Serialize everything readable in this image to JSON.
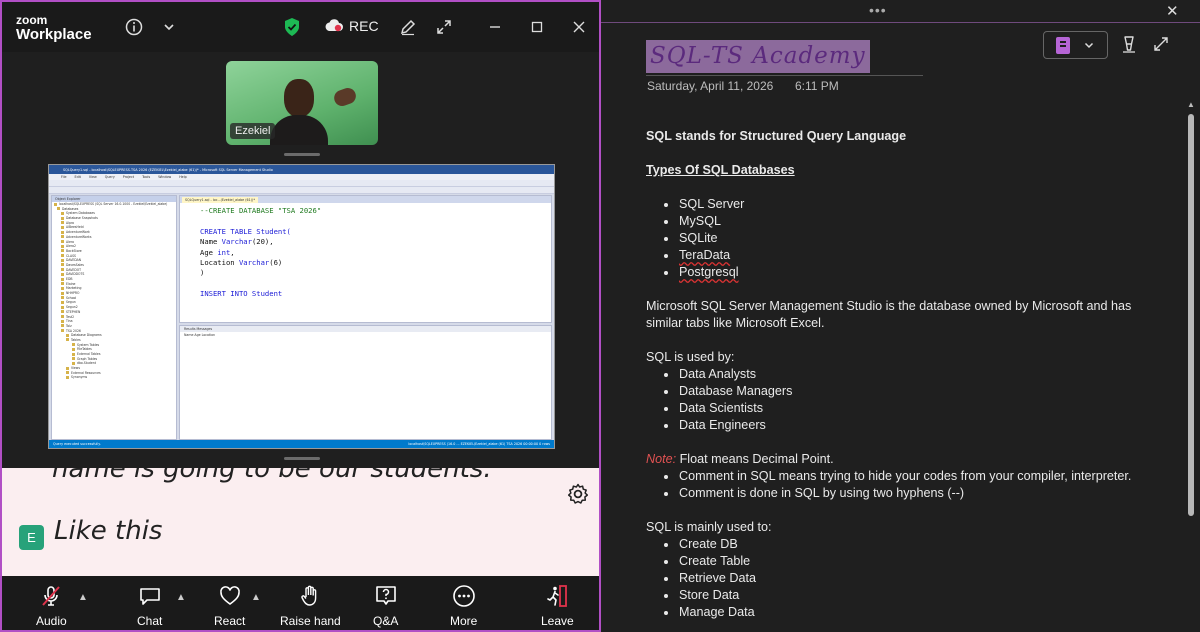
{
  "zoom": {
    "logo_line1": "zoom",
    "logo_line2": "Workplace",
    "rec_label": "REC",
    "participant_name": "Ezekiel",
    "shared_screen": {
      "window_title": "SQLQuery1.sql - localhost\\SQLEXPRESS.TSA 2026 (EZEKIEL\\Ezekiel_alabe (61))* - Microsoft SQL Server Management Studio",
      "menu": [
        "File",
        "Edit",
        "View",
        "Query",
        "Project",
        "Tools",
        "Window",
        "Help"
      ],
      "explorer_header": "Object Explorer",
      "tree": [
        "localhost\\SQLEXPRESS (SQL Server 16.0.1000 - Ezekiel\\Ezekiel_alabe)",
        "Databases",
        "System Databases",
        "Database Snapshots",
        "Alpro",
        "AlBeesHeld",
        "AdventureWork",
        "AdventureWorks",
        "Alero",
        "Alero2",
        "BackStore",
        "CLASS",
        "DAVEDAN",
        "DavesSales",
        "DAVEDOT",
        "DAVIDDOTS",
        "EDB",
        "Elaine",
        "Marketing",
        "NHHPRO",
        "School",
        "Segun",
        "Segun2",
        "STEPHEN",
        "Test2",
        "Tina",
        "Tolz",
        "TSA 2026",
        "Database Diagrams",
        "Tables",
        "System Tables",
        "FileTables",
        "External Tables",
        "Graph Tables",
        "dbo.Student",
        "Views",
        "External Resources",
        "Synonyms"
      ],
      "tab_label": "SQLQuery1.sql - loc...(Ezekiel_alabe (61))*",
      "code_lines": [
        {
          "text": "--CREATE DATABASE \"TSA 2026\"",
          "kind": "cm"
        },
        {
          "text": "",
          "kind": ""
        },
        {
          "text": "CREATE TABLE Student(",
          "kind": "kw"
        },
        {
          "text": "Name Varchar(20),",
          "kind": "mix"
        },
        {
          "text": "Age int,",
          "kind": "mix"
        },
        {
          "text": "Location Varchar(6)",
          "kind": "mix"
        },
        {
          "text": ")",
          "kind": ""
        },
        {
          "text": "",
          "kind": ""
        },
        {
          "text": "INSERT INTO Student",
          "kind": "kw"
        }
      ],
      "results_tabs": "Results   Messages",
      "results_columns": "Name   Age   Location",
      "status_left": "Query executed successfully.",
      "status_right": "localhost\\SQLEXPRESS (16.0 ...  EZEKIEL\\Ezekiel_alabe (61)  TSA 2026  00:00:00  0 rows"
    },
    "caption_previous": "name is going to be our students.",
    "caption_badge": "E",
    "caption_current": "Like this",
    "toolbar": {
      "audio": "Audio",
      "chat": "Chat",
      "react": "React",
      "raise_hand": "Raise hand",
      "qa": "Q&A",
      "more": "More",
      "leave": "Leave"
    }
  },
  "onenote": {
    "dots": "•••",
    "close": "✕",
    "page_title": "SQL-TS Academy",
    "date": "Saturday, April 11, 2026",
    "time": "6:11 PM",
    "intro": "SQL stands for Structured Query Language",
    "types_heading": "Types Of SQL Databases",
    "types": [
      "SQL Server",
      "MySQL",
      "SQLite",
      "TeraData",
      "Postgresql"
    ],
    "ssms_paragraph": "Microsoft SQL Server Management Studio is the database owned by Microsoft and has similar tabs like Microsoft Excel.",
    "used_by_heading": "SQL is used by:",
    "used_by": [
      "Data Analysts",
      "Database Managers",
      "Data Scientists",
      "Data Engineers"
    ],
    "note_label": "Note:",
    "note_text": " Float means Decimal Point.",
    "note_bullets": [
      "Comment in SQL means trying to hide your codes from your compiler, interpreter.",
      "Comment is done in SQL by using two hyphens (--)"
    ],
    "mainly_heading": "SQL is mainly used to:",
    "mainly": [
      "Create DB",
      "Create Table",
      "Retrieve Data",
      "Store Data",
      "Manage Data"
    ]
  },
  "colors": {
    "zoom_border": "#b14fc5",
    "shield_green": "#1db954",
    "rec_red": "#e0334c",
    "leave_red": "#e0334c",
    "title_highlight": "#8c6a9c",
    "title_text": "#5b2a7d",
    "note_red": "#e05252"
  }
}
